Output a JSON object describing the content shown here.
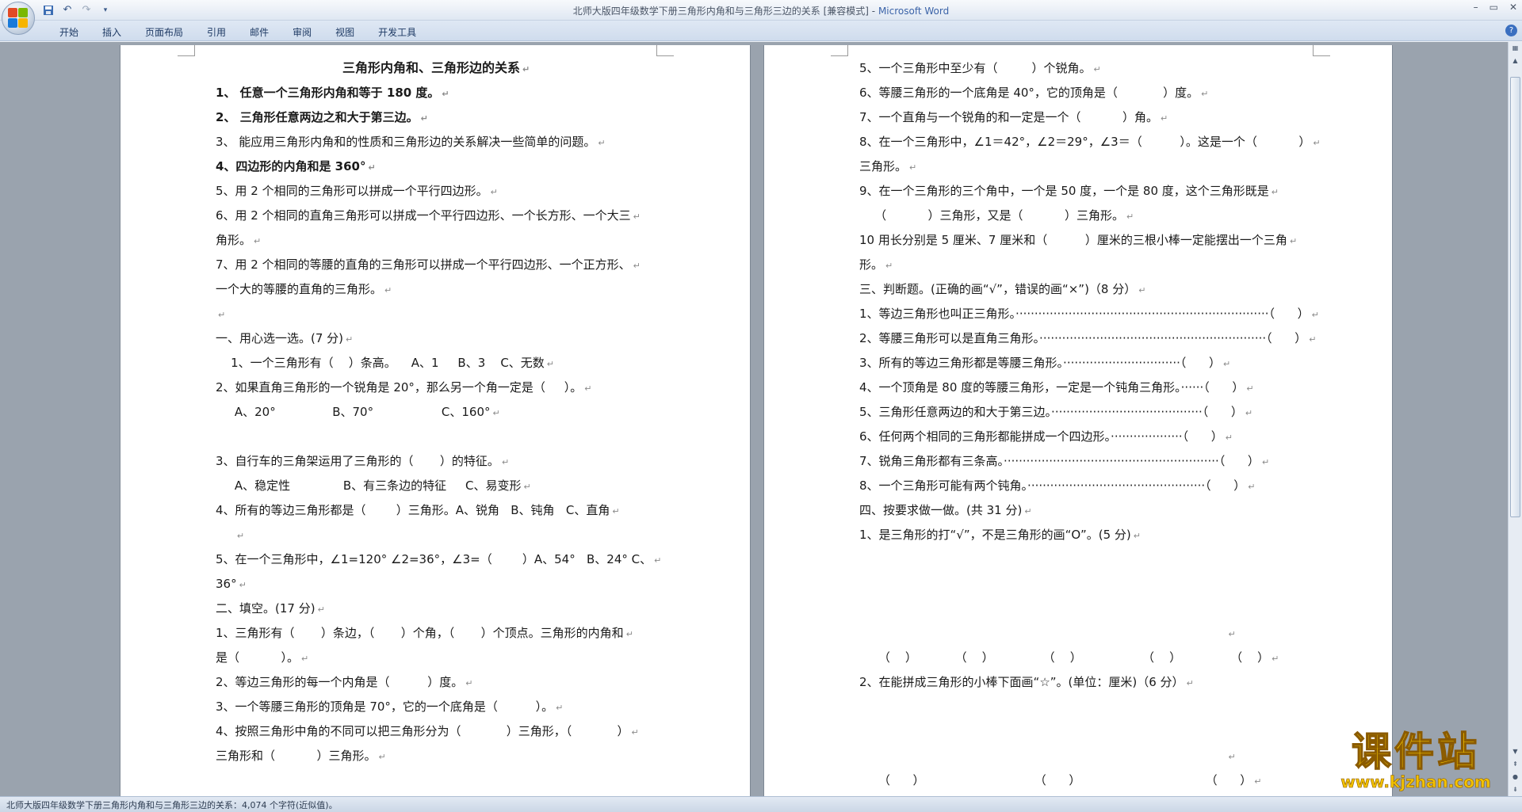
{
  "window": {
    "title": "北师大版四年级数学下册三角形内角和与三角形三边的关系 [兼容模式]",
    "app_name": "Microsoft Word",
    "controls": [
      "–",
      "▭",
      "✕"
    ]
  },
  "ribbon": {
    "tabs": [
      "开始",
      "插入",
      "页面布局",
      "引用",
      "邮件",
      "审阅",
      "视图",
      "开发工具"
    ],
    "help": "?"
  },
  "left_page": [
    {
      "text": "三角形内角和、三角形边的关系",
      "style": "title"
    },
    {
      "text": "1、 任意一个三角形内角和等于 180 度。",
      "style": "bold"
    },
    {
      "text": "2、 三角形任意两边之和大于第三边。",
      "style": "bold"
    },
    {
      "text": "3、 能应用三角形内角和的性质和三角形边的关系解决一些简单的问题。",
      "style": ""
    },
    {
      "text": "4、四边形的内角和是 360°",
      "style": "bold"
    },
    {
      "text": "5、用 2 个相同的三角形可以拼成一个平行四边形。",
      "style": ""
    },
    {
      "text": "6、用 2 个相同的直角三角形可以拼成一个平行四边形、一个长方形、一个大三",
      "style": ""
    },
    {
      "text": "角形。",
      "style": ""
    },
    {
      "text": "7、用 2 个相同的等腰的直角的三角形可以拼成一个平行四边形、一个正方形、",
      "style": ""
    },
    {
      "text": "一个大的等腰的直角的三角形。",
      "style": ""
    },
    {
      "text": "",
      "style": ""
    },
    {
      "text": "一、用心选一选。(7 分)",
      "style": ""
    },
    {
      "text": "    1、一个三角形有（    ）条高。    A、1     B、3    C、无数",
      "style": ""
    },
    {
      "text": "2、如果直角三角形的一个锐角是 20°，那么另一个角一定是（     ）。",
      "style": ""
    },
    {
      "text": "     A、20°               B、70°                  C、160°",
      "style": ""
    },
    {
      "text": "",
      "style": "",
      "skip": true
    },
    {
      "text": "3、自行车的三角架运用了三角形的（       ）的特征。",
      "style": ""
    },
    {
      "text": "     A、稳定性              B、有三条边的特征     C、易变形",
      "style": ""
    },
    {
      "text": "4、所有的等边三角形都是（        ）三角形。A、锐角   B、钝角   C、直角",
      "style": ""
    },
    {
      "text": "     ",
      "style": ""
    },
    {
      "text": "5、在一个三角形中，∠1=120° ∠2=36°，∠3=（        ）A、54°   B、24° C、",
      "style": ""
    },
    {
      "text": "36°",
      "style": ""
    },
    {
      "text": "二、填空。(17 分)",
      "style": ""
    },
    {
      "text": "1、三角形有（       ）条边，（       ）个角，（       ）个顶点。三角形的内角和",
      "style": ""
    },
    {
      "text": "是（           ）。",
      "style": ""
    },
    {
      "text": "2、等边三角形的每一个内角是（          ）度。",
      "style": ""
    },
    {
      "text": "3、一个等腰三角形的顶角是 70°，它的一个底角是（          ）。",
      "style": ""
    },
    {
      "text": "4、按照三角形中角的不同可以把三角形分为（            ）三角形，（            ）",
      "style": ""
    },
    {
      "text": "三角形和（           ）三角形。",
      "style": ""
    }
  ],
  "right_page": [
    {
      "text": "5、一个三角形中至少有（         ）个锐角。"
    },
    {
      "text": "6、等腰三角形的一个底角是 40°，它的顶角是（            ）度。"
    },
    {
      "text": "7、一个直角与一个锐角的和一定是一个（           ）角。"
    },
    {
      "text": "8、在一个三角形中，∠1＝42°，∠2＝29°，∠3＝（          ）。这是一个（           ）"
    },
    {
      "text": "三角形。"
    },
    {
      "text": "9、在一个三角形的三个角中，一个是 50 度，一个是 80 度，这个三角形既是"
    },
    {
      "text": "    （           ）三角形，又是（           ）三角形。"
    },
    {
      "text": "10 用长分别是 5 厘米、7 厘米和（          ）厘米的三根小棒一定能摆出一个三角"
    },
    {
      "text": "形。"
    },
    {
      "text": "三、判断题。(正确的画“√”，错误的画“×”)（8 分）"
    },
    {
      "text": "1、等边三角形也叫正三角形。···································································（      ）"
    },
    {
      "text": "2、等腰三角形可以是直角三角形。····························································（      ）"
    },
    {
      "text": "3、所有的等边三角形都是等腰三角形。·······························（      ）"
    },
    {
      "text": "4、一个顶角是 80 度的等腰三角形，一定是一个钝角三角形。······（      ）"
    },
    {
      "text": "5、三角形任意两边的和大于第三边。········································（      ）"
    },
    {
      "text": "6、任何两个相同的三角形都能拼成一个四边形。···················（      ）"
    },
    {
      "text": "7、锐角三角形都有三条高。·························································（      ）"
    },
    {
      "text": "8、一个三角形可能有两个钝角。···············································（      ）"
    },
    {
      "text": "四、按要求做一做。(共 31 分)"
    },
    {
      "text": "1、是三角形的打“√”，不是三角形的画“O”。(5 分)"
    },
    {
      "text": "                                                                                                 ",
      "gap": 3
    },
    {
      "text": "     （    ）          （    ）             （    ）                （    ）             （    ）"
    },
    {
      "text": "2、在能拼成三角形的小棒下面画“☆”。(单位：厘米)（6 分）"
    },
    {
      "text": "                                                                                                 ",
      "gap": 2
    },
    {
      "text": "     （      ）                             （      ）                                 （      ）"
    },
    {
      "text": "     "
    }
  ],
  "status_bar": {
    "text": "北师大版四年级数学下册三角形内角和与三角形三边的关系：4,074 个字符(近似值)。"
  },
  "watermark": {
    "cn": "课件站",
    "url": "www.kjzhan.com"
  }
}
